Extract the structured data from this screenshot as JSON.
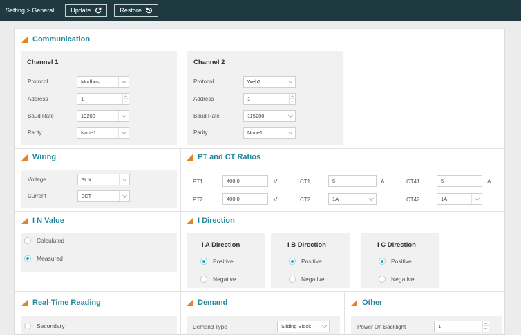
{
  "header": {
    "breadcrumb": "Setting > General",
    "update_label": "Update",
    "restore_label": "Restore"
  },
  "communication": {
    "title": "Communication",
    "channel1": {
      "title": "Channel 1",
      "protocol_label": "Protocol",
      "protocol_value": "Modbus",
      "address_label": "Address",
      "address_value": "1",
      "baud_label": "Baud Rate",
      "baud_value": "19200",
      "parity_label": "Parity",
      "parity_value": "None1"
    },
    "channel2": {
      "title": "Channel 2",
      "protocol_label": "Protocol",
      "protocol_value": "Web2",
      "address_label": "Address",
      "address_value": "1",
      "baud_label": "Baud Rate",
      "baud_value": "115200",
      "parity_label": "Parity",
      "parity_value": "None1"
    }
  },
  "wiring": {
    "title": "Wiring",
    "voltage_label": "Voltage",
    "voltage_value": "3LN",
    "current_label": "Current",
    "current_value": "3CT"
  },
  "pt_ct": {
    "title": "PT and CT Ratios",
    "pt1_label": "PT1",
    "pt1_value": "400.0",
    "pt1_unit": "V",
    "pt2_label": "PT2",
    "pt2_value": "400.0",
    "pt2_unit": "V",
    "ct1_label": "CT1",
    "ct1_value": "5",
    "ct1_unit": "A",
    "ct2_label": "CT2",
    "ct2_value": "1A",
    "ct41_label": "CT41",
    "ct41_value": "5",
    "ct41_unit": "A",
    "ct42_label": "CT42",
    "ct42_value": "1A"
  },
  "in_value": {
    "title": "I N Value",
    "option1": "Calculated",
    "option2": "Measured",
    "selected": "Measured"
  },
  "i_direction": {
    "title": "I Direction",
    "a": {
      "title": "I A Direction",
      "positive": "Positive",
      "negative": "Negative",
      "selected": "Positive"
    },
    "b": {
      "title": "I B Direction",
      "positive": "Positive",
      "negative": "Negative",
      "selected": "Positive"
    },
    "c": {
      "title": "I C Direction",
      "positive": "Positive",
      "negative": "Negative",
      "selected": "Positive"
    }
  },
  "realtime": {
    "title": "Real-Time Reading",
    "option1": "Secondary"
  },
  "demand": {
    "title": "Demand",
    "type_label": "Demand Type",
    "type_value": "Sliding Block"
  },
  "other": {
    "title": "Other",
    "backlight_label": "Power On Backlight",
    "backlight_value": "1"
  },
  "colors": {
    "header_bg": "#1e3a40",
    "accent": "#25869b",
    "marker": "#e8821e",
    "radio_selected": "#2aa3bd"
  },
  "icons": {
    "update": "refresh-icon",
    "restore": "restore-icon"
  }
}
